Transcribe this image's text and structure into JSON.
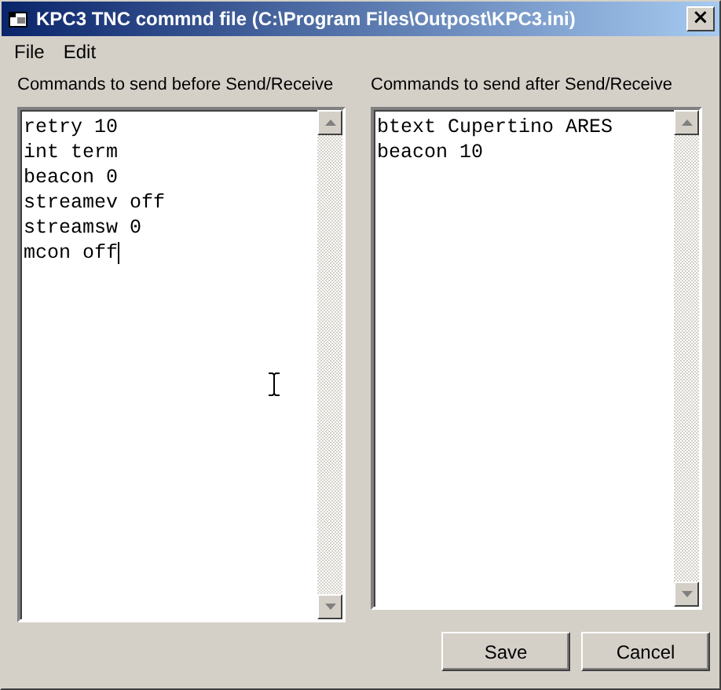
{
  "window": {
    "title": "KPC3 TNC commnd file (C:\\Program Files\\Outpost\\KPC3.ini)",
    "close": "×"
  },
  "menu": [
    "File",
    "Edit"
  ],
  "panels": [
    {
      "label": "Commands to send before Send/Receive",
      "focused": true,
      "lines": [
        "retry 10",
        "int term",
        "beacon 0",
        "streamev off",
        "streamsw 0",
        "mcon off"
      ]
    },
    {
      "label": "Commands to send after Send/Receive",
      "focused": false,
      "lines": [
        "btext Cupertino ARES",
        "beacon 10"
      ]
    }
  ],
  "buttons": [
    "Save",
    "Cancel"
  ]
}
